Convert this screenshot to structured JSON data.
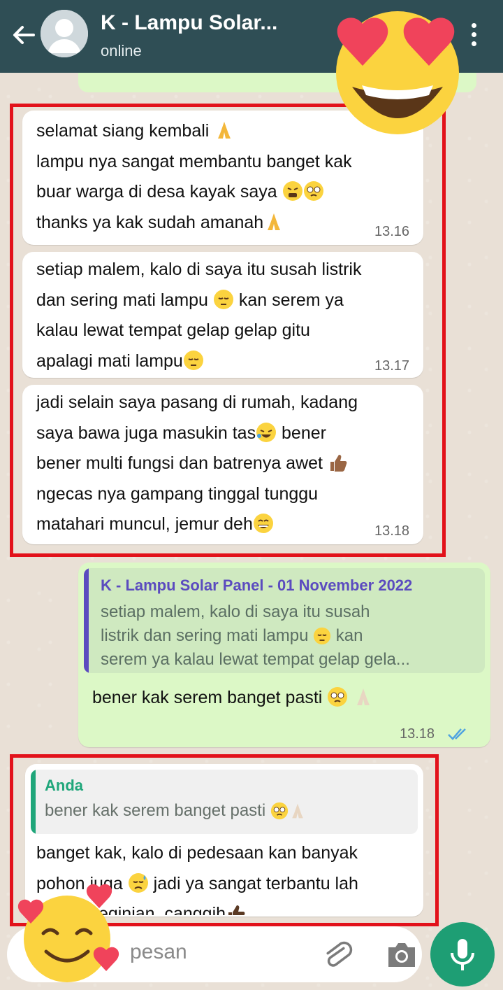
{
  "header": {
    "contact_name": "K - Lampu Solar...",
    "status": "online"
  },
  "messages": [
    {
      "direction": "incoming",
      "lines": [
        "selamat siang kembali",
        "lampu nya sangat membantu banget kak",
        "buar warga di desa kayak saya",
        "thanks ya kak sudah amanah"
      ],
      "time": "13.16"
    },
    {
      "direction": "incoming",
      "lines": [
        "setiap malem, kalo di saya itu susah listrik",
        "dan sering mati lampu",
        "kan serem ya",
        "kalau lewat tempat gelap gelap gitu",
        "apalagi mati lampu"
      ],
      "time": "13.17"
    },
    {
      "direction": "incoming",
      "lines": [
        "jadi selain saya pasang di rumah, kadang",
        "saya bawa juga masukin tas",
        "bener",
        "bener multi fungsi dan batrenya awet",
        "ngecas nya gampang tinggal tunggu",
        "matahari muncul, jemur deh"
      ],
      "time": "13.18"
    },
    {
      "direction": "outgoing",
      "quote_author": "K - Lampu Solar Panel - 01 November 2022",
      "quote_lines": [
        "setiap malem, kalo di saya itu susah",
        "listrik dan sering mati lampu",
        "kan",
        "serem ya kalau lewat tempat gelap gela..."
      ],
      "text": "bener kak serem banget pasti",
      "time": "13.18"
    },
    {
      "direction": "incoming",
      "quote_author": "Anda",
      "quote_text": "bener kak serem banget pasti",
      "lines": [
        "banget kak, kalo di pedesaan kan banyak",
        "pohon juga",
        "jadi ya sangat terbantu lah",
        "lampu beginian, canggih"
      ]
    }
  ],
  "input": {
    "placeholder": "pesan"
  },
  "colors": {
    "header_bg": "#2f4e55",
    "outgoing_bubble": "#dcf8c6",
    "highlight_border": "#e2121b",
    "mic_button": "#1e9e74",
    "read_ticks": "#4fa3e0"
  },
  "icons": [
    "back-arrow-icon",
    "avatar-icon",
    "menu-dots-icon",
    "heart-eyes-emoji",
    "smiling-hearts-emoji",
    "paperclip-icon",
    "camera-icon",
    "mic-icon",
    "double-check-icon"
  ]
}
